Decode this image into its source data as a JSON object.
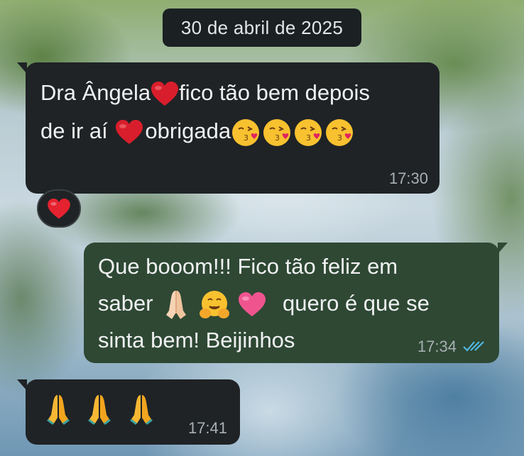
{
  "chat": {
    "date_separator": "30 de abril de 2025",
    "messages": [
      {
        "direction": "incoming",
        "lines": [
          "Dra Ângela",
          "fico tão bem depois",
          "de ir aí",
          "obrigada"
        ],
        "time": "17:30",
        "reaction": "red-heart"
      },
      {
        "direction": "outgoing",
        "lines": [
          "Que booom!!! Fico tão feliz em",
          "saber",
          "quero é que se",
          "sinta bem! Beijinhos"
        ],
        "time": "17:34",
        "status": "read"
      },
      {
        "direction": "incoming",
        "emojis": [
          "folded-hands",
          "folded-hands",
          "folded-hands"
        ],
        "time": "17:41"
      }
    ]
  },
  "colors": {
    "incoming_bubble": "#1f2326",
    "outgoing_bubble": "#2e4834",
    "read_ticks": "#53bdeb",
    "heart_red": "#d81e2c",
    "pink_heart": "#f0548f"
  }
}
